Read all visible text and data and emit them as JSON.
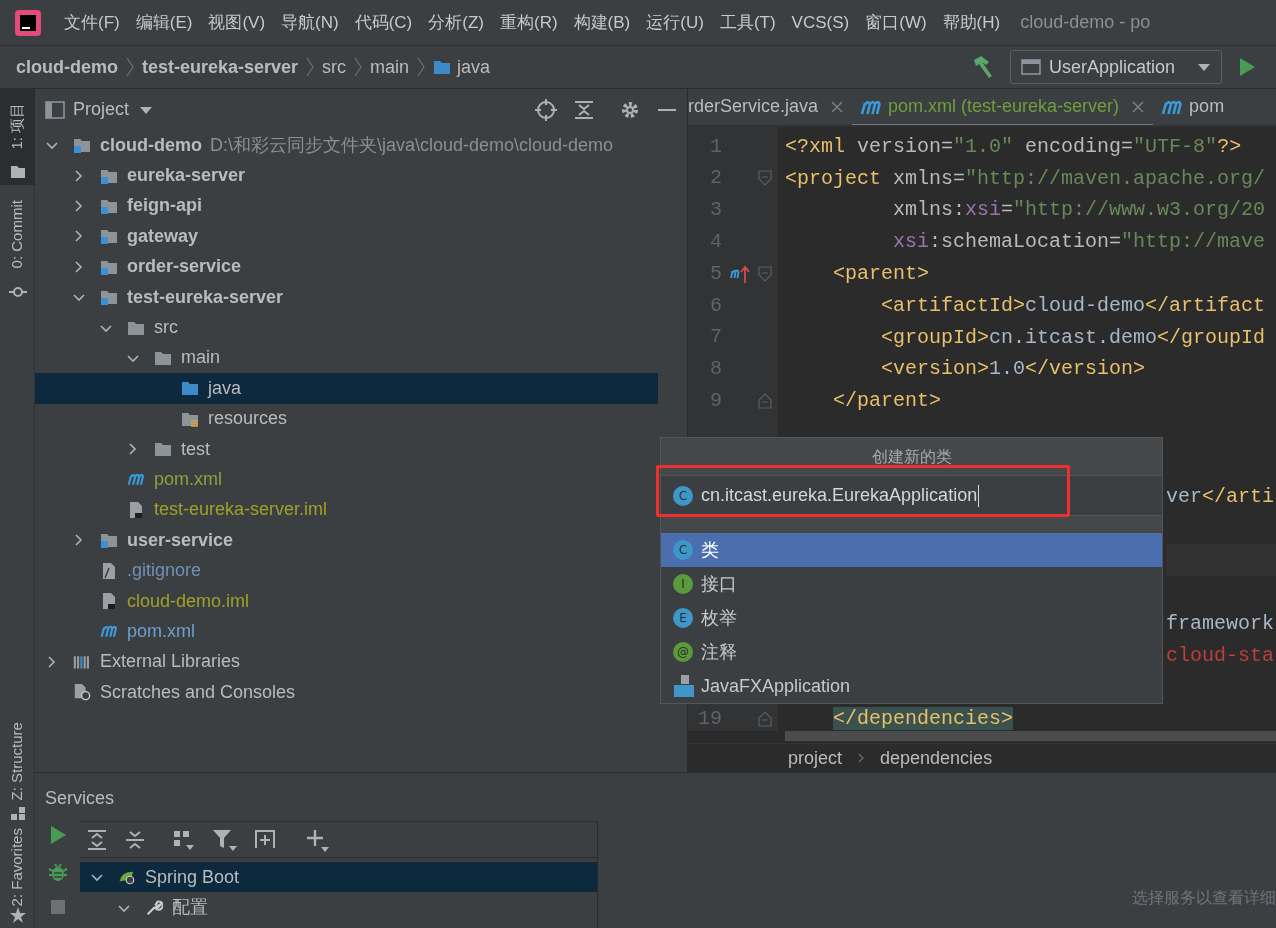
{
  "window": {
    "title": "cloud-demo - po"
  },
  "menu": [
    {
      "label": "文件(F)"
    },
    {
      "label": "编辑(E)"
    },
    {
      "label": "视图(V)"
    },
    {
      "label": "导航(N)"
    },
    {
      "label": "代码(C)"
    },
    {
      "label": "分析(Z)"
    },
    {
      "label": "重构(R)"
    },
    {
      "label": "构建(B)"
    },
    {
      "label": "运行(U)"
    },
    {
      "label": "工具(T)"
    },
    {
      "label": "VCS(S)"
    },
    {
      "label": "窗口(W)"
    },
    {
      "label": "帮助(H)"
    }
  ],
  "breadcrumbs": [
    {
      "label": "cloud-demo",
      "kind": "module"
    },
    {
      "label": "test-eureka-server",
      "kind": "module"
    },
    {
      "label": "src",
      "kind": "plain"
    },
    {
      "label": "main",
      "kind": "plain"
    },
    {
      "label": "java",
      "kind": "source-folder"
    }
  ],
  "run_config": {
    "label": "UserApplication"
  },
  "side_tabs": [
    {
      "label": "1: 项目",
      "kind": "project",
      "selected": true
    },
    {
      "label": "0: Commit",
      "kind": "commit",
      "selected": false
    },
    {
      "label": "Z: Structure",
      "kind": "structure",
      "selected": false
    },
    {
      "label": "2: Favorites",
      "kind": "favorites",
      "selected": false
    }
  ],
  "project": {
    "title": "Project",
    "tree": [
      {
        "label": "cloud-demo",
        "path": "D:\\和彩云同步文件夹\\java\\cloud-demo\\cloud-demo",
        "kind": "module",
        "expanded": true,
        "selected": false,
        "children": [
          {
            "label": "eureka-server",
            "kind": "module",
            "expanded": false,
            "selected": false
          },
          {
            "label": "feign-api",
            "kind": "module",
            "expanded": false,
            "selected": false
          },
          {
            "label": "gateway",
            "kind": "module",
            "expanded": false,
            "selected": false
          },
          {
            "label": "order-service",
            "kind": "module",
            "expanded": false,
            "selected": false
          },
          {
            "label": "test-eureka-server",
            "kind": "module",
            "expanded": true,
            "selected": false,
            "children": [
              {
                "label": "src",
                "kind": "folder",
                "expanded": true,
                "selected": false,
                "children": [
                  {
                    "label": "main",
                    "kind": "folder",
                    "expanded": true,
                    "selected": false,
                    "children": [
                      {
                        "label": "java",
                        "kind": "source-folder",
                        "selected": true
                      },
                      {
                        "label": "resources",
                        "kind": "resource-folder",
                        "selected": false
                      }
                    ]
                  },
                  {
                    "label": "test",
                    "kind": "folder",
                    "expanded": false,
                    "selected": false
                  }
                ]
              },
              {
                "label": "pom.xml",
                "kind": "maven",
                "color": "#8aa33c",
                "selected": false
              },
              {
                "label": "test-eureka-server.iml",
                "kind": "iml",
                "color": "#a0a028",
                "selected": false
              }
            ]
          },
          {
            "label": "user-service",
            "kind": "module",
            "expanded": false,
            "selected": false
          },
          {
            "label": ".gitignore",
            "kind": "ignore",
            "color": "#7090b4",
            "selected": false
          },
          {
            "label": "cloud-demo.iml",
            "kind": "iml",
            "color": "#a0a028",
            "selected": false
          },
          {
            "label": "pom.xml",
            "kind": "maven",
            "color": "#6a9fd0",
            "selected": false
          }
        ]
      },
      {
        "label": "External Libraries",
        "kind": "libraries",
        "expanded": false,
        "selected": false
      },
      {
        "label": "Scratches and Consoles",
        "kind": "scratches",
        "selected": false
      }
    ]
  },
  "editor": {
    "tabs": [
      {
        "label": "rderService.java",
        "kind": "java",
        "selected": false
      },
      {
        "label": "pom.xml (test-eureka-server)",
        "kind": "maven",
        "selected": true
      },
      {
        "label": "pom",
        "kind": "maven",
        "selected": false
      }
    ],
    "lines": [
      {
        "number": "1",
        "segments": [
          {
            "text": "<?xml",
            "kind": "tag"
          },
          {
            "text": " version=",
            "kind": "attr"
          },
          {
            "text": "\"1.0\"",
            "kind": "value"
          },
          {
            "text": " encoding=",
            "kind": "attr"
          },
          {
            "text": "\"UTF-8\"",
            "kind": "value"
          },
          {
            "text": "?>",
            "kind": "tag"
          }
        ]
      },
      {
        "number": "2",
        "fold_start": true,
        "segments": [
          {
            "text": "<project",
            "kind": "tag"
          },
          {
            "text": " xmlns=",
            "kind": "attr"
          },
          {
            "text": "\"http://maven.apache.org/",
            "kind": "value"
          }
        ]
      },
      {
        "number": "3",
        "segments": [
          {
            "text": "         xmlns:",
            "kind": "attr"
          },
          {
            "text": "xsi",
            "kind": "ns"
          },
          {
            "text": "=",
            "kind": "attr"
          },
          {
            "text": "\"http://www.w3.org/20",
            "kind": "value"
          }
        ]
      },
      {
        "number": "4",
        "segments": [
          {
            "text": "         xsi",
            "kind": "ns"
          },
          {
            "text": ":schemaLocation=",
            "kind": "attr"
          },
          {
            "text": "\"http://mave",
            "kind": "value"
          }
        ]
      },
      {
        "number": "5",
        "override_marker": true,
        "fold_start": true,
        "segments": [
          {
            "text": "    <parent>",
            "kind": "tag"
          }
        ]
      },
      {
        "number": "6",
        "segments": [
          {
            "text": "        <artifactId>",
            "kind": "tag"
          },
          {
            "text": "cloud-demo",
            "kind": "text"
          },
          {
            "text": "</artifact",
            "kind": "tag"
          }
        ]
      },
      {
        "number": "7",
        "segments": [
          {
            "text": "        <groupId>",
            "kind": "tag"
          },
          {
            "text": "cn.itcast.demo",
            "kind": "text"
          },
          {
            "text": "</groupId",
            "kind": "tag"
          }
        ]
      },
      {
        "number": "8",
        "segments": [
          {
            "text": "        <version>",
            "kind": "tag"
          },
          {
            "text": "1.0",
            "kind": "text"
          },
          {
            "text": "</version>",
            "kind": "tag"
          }
        ]
      },
      {
        "number": "9",
        "fold_end": true,
        "segments": [
          {
            "text": "    </parent>",
            "kind": "tag"
          }
        ]
      },
      {
        "behind_popup": true
      },
      {
        "behind_popup": true
      },
      {
        "behind_popup": true,
        "segments": [
          {
            "text": "ver",
            "kind": "text"
          },
          {
            "text": "</arti",
            "kind": "tag"
          }
        ]
      },
      {
        "behind_popup": true
      },
      {
        "behind_popup": true,
        "current": true
      },
      {
        "behind_popup": true
      },
      {
        "behind_popup": true,
        "segments": [
          {
            "text": "framework",
            "kind": "text"
          }
        ]
      },
      {
        "behind_popup": true,
        "segments": [
          {
            "text": "cloud-sta",
            "kind": "error"
          }
        ]
      },
      {
        "behind_popup": true
      },
      {
        "number": "19",
        "fold_end": true,
        "matched": true,
        "segments": [
          {
            "text": "    </dependencies>",
            "kind": "tag"
          }
        ]
      }
    ],
    "path": [
      {
        "label": "project"
      },
      {
        "label": "dependencies"
      }
    ]
  },
  "popup": {
    "title": "创建新的类",
    "input": {
      "value": "cn.itcast.eureka.EurekaApplication",
      "badge": "C"
    },
    "items": [
      {
        "label": "类",
        "kind": "class",
        "badge": "C",
        "selected": true
      },
      {
        "label": "接口",
        "kind": "interface",
        "badge": "I",
        "selected": false
      },
      {
        "label": "枚举",
        "kind": "enum",
        "badge": "E",
        "selected": false
      },
      {
        "label": "注释",
        "kind": "annotation",
        "badge": "@",
        "selected": false
      },
      {
        "label": "JavaFXApplication",
        "kind": "javafx",
        "selected": false
      }
    ]
  },
  "services": {
    "title": "Services",
    "tree": [
      {
        "label": "Spring Boot",
        "kind": "spring",
        "expanded": true,
        "selected": true,
        "children": [
          {
            "label": "配置",
            "kind": "config",
            "expanded": true,
            "selected": false
          }
        ]
      }
    ],
    "hint": "选择服务以查看详细"
  }
}
